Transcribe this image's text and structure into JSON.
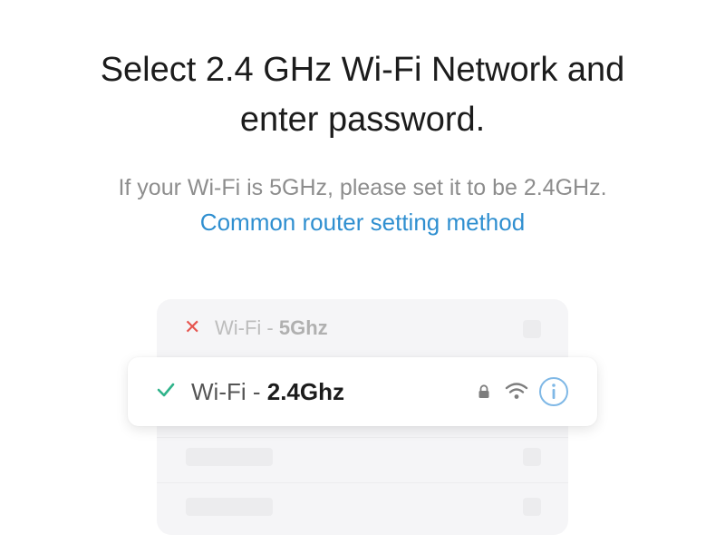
{
  "header": {
    "title_line1": "Select 2.4 GHz Wi-Fi Network and",
    "title_line2": "enter password.",
    "subtitle": "If your Wi-Fi is 5GHz, please set it to be 2.4GHz.",
    "link": "Common router setting method"
  },
  "networks": [
    {
      "prefix": "Wi-Fi - ",
      "band": "5Ghz",
      "status": "invalid",
      "status_icon": "x-icon"
    },
    {
      "prefix": "Wi-Fi - ",
      "band": "2.4Ghz",
      "status": "valid",
      "status_icon": "check-icon",
      "icons": [
        "lock-icon",
        "wifi-icon",
        "info-icon"
      ]
    }
  ],
  "colors": {
    "link": "#2f8fd0",
    "invalid": "#e6554f",
    "valid": "#2fb38a",
    "info": "#7fb8e6"
  }
}
